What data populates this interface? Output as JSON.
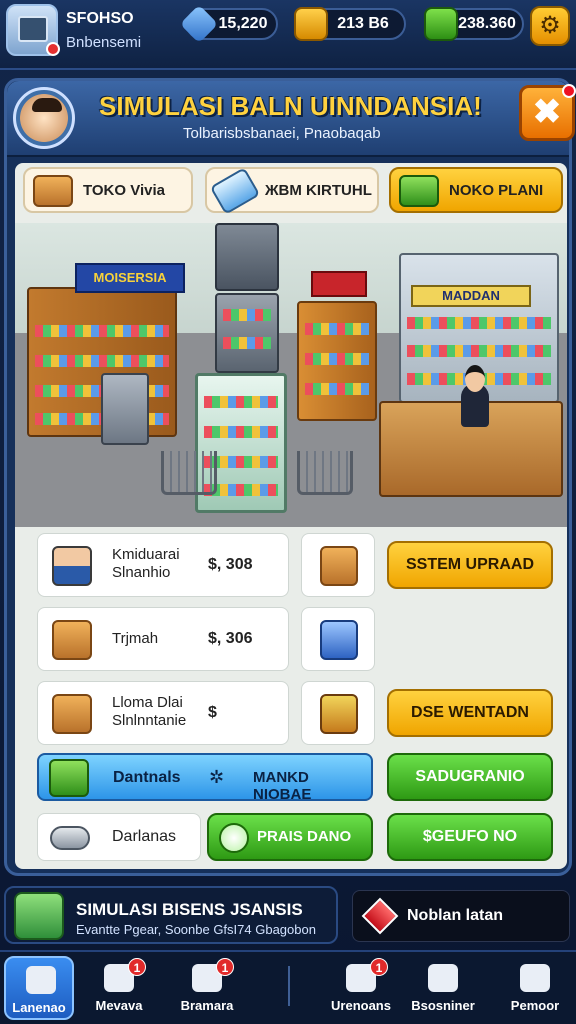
{
  "topbar": {
    "player_name": "SFOHSO",
    "player_sub": "Bnbensemi",
    "gems": "15,220",
    "gold": "213 B6",
    "cash": "238.360",
    "settings_glyph": "⚙"
  },
  "header": {
    "title": "SIMULASI BALN UINNDANSIA!",
    "subtitle": "Tolbarisbsbanaei, Pnaobaqab",
    "close_glyph": "✖"
  },
  "tabs": [
    {
      "label": "TOKO Vivia",
      "icon": "box-icon"
    },
    {
      "label": "ЖВМ KIRTUHL",
      "icon": "vr-headset-icon"
    },
    {
      "label": "NOKO PLANI",
      "icon": "money-icon"
    }
  ],
  "scene": {
    "sign_left": "MOISERSIA",
    "sign_center": "",
    "sign_mid": "",
    "sign_right": "MADDAN"
  },
  "rows": [
    {
      "name_line1": "Kmiduarai",
      "name_line2": "Slnanhio",
      "price": "$, 308",
      "action": "SSTEM UPRAAD"
    },
    {
      "name_line1": "Trjmah",
      "name_line2": "",
      "price": "$, 306",
      "action": ""
    },
    {
      "name_line1": "Lloma Dlai",
      "name_line2": "Slnlnntanie",
      "price": "$",
      "action": "DSE WENTADN"
    }
  ],
  "green_actions": [
    "SADUGRANIO",
    "$GEUFO NO"
  ],
  "blue_bar": {
    "left": "Dantnals",
    "symbol": "✲",
    "right": "MANKD NIOBAE"
  },
  "last_row": {
    "label": "Darlanas",
    "button": "PRAIS DANO"
  },
  "status": {
    "title": "SIMULASI BISENS JSANSIS",
    "sub": "Evantte Pgear, Soonbe GfsI74 Gbagobon"
  },
  "notification": {
    "text": "Noblan latan"
  },
  "nav": [
    {
      "label": "Lanenao",
      "badge": ""
    },
    {
      "label": "Mevava",
      "badge": "1"
    },
    {
      "label": "Bramara",
      "badge": "1"
    },
    {
      "label": "Urenoans",
      "badge": "1"
    },
    {
      "label": "Bsosniner",
      "badge": ""
    },
    {
      "label": "Pemoor",
      "badge": ""
    }
  ]
}
